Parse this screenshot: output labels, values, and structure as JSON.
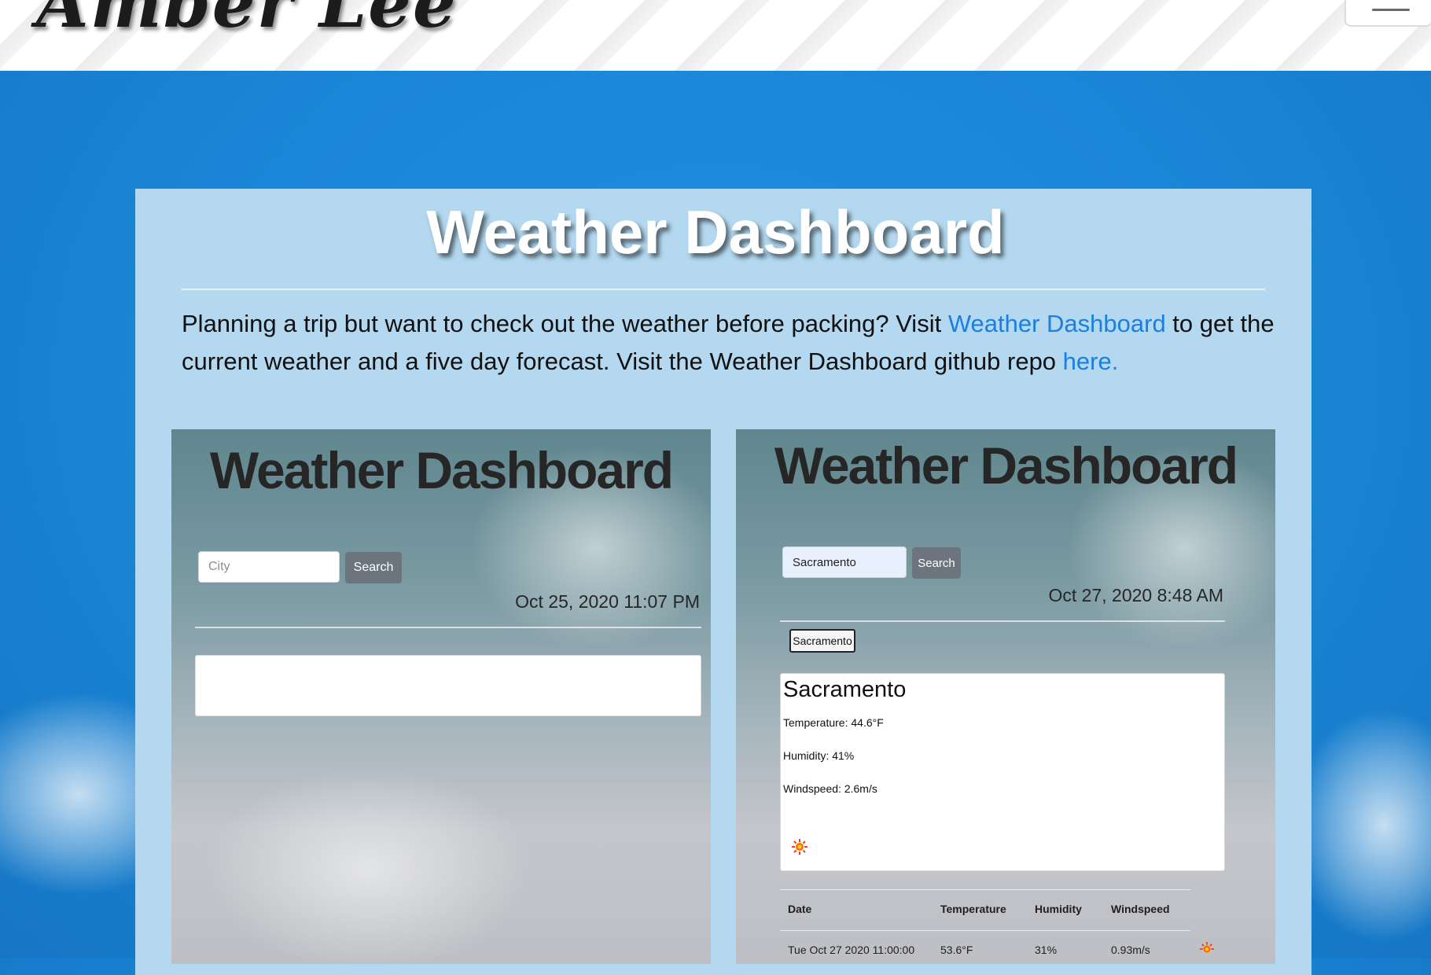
{
  "header": {
    "signature": "Amber Lee"
  },
  "card": {
    "title": "Weather Dashboard",
    "desc_before": "Planning a trip but want to check out the weather before packing? Visit ",
    "desc_link1": "Weather Dashboard",
    "desc_middle": " to get the current weather and a five day forecast. Visit the Weather Dashboard github repo ",
    "desc_link2": "here."
  },
  "screenshot_left": {
    "title": "Weather Dashboard",
    "city_placeholder": "City",
    "search_label": "Search",
    "datetime": "Oct 25, 2020 11:07 PM"
  },
  "screenshot_right": {
    "title": "Weather Dashboard",
    "city_value": "Sacramento",
    "search_label": "Search",
    "datetime": "Oct 27, 2020 8:48 AM",
    "history_city": "Sacramento",
    "current": {
      "city": "Sacramento",
      "temperature": "Temperature: 44.6°F",
      "humidity": "Humidity: 41%",
      "windspeed": "Windspeed: 2.6m/s",
      "icon": "sun-icon"
    },
    "forecast": {
      "headers": [
        "Date",
        "Temperature",
        "Humidity",
        "Windspeed"
      ],
      "rows": [
        {
          "date": "Tue Oct 27 2020 11:00:00",
          "temperature": "53.6°F",
          "humidity": "31%",
          "windspeed": "0.93m/s",
          "icon": "sun-icon"
        }
      ]
    }
  },
  "colors": {
    "page_bg": "#1a85d6",
    "card_bg": "#b3d8ef",
    "link": "#1a7fe0",
    "button_gray": "#6c757d"
  }
}
